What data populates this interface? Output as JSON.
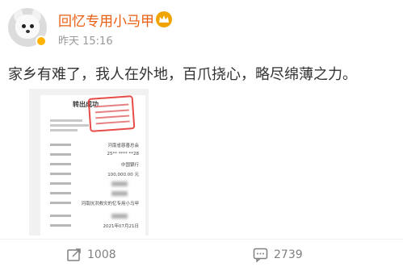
{
  "post": {
    "username": "回忆专用小马甲",
    "time": "昨天 15:16",
    "text": "家乡有难了，我人在外地，百爪挠心，略尽绵薄之力。"
  },
  "receipt": {
    "title": "转出成功",
    "rows": [
      {
        "value": "河南省慈善总会"
      },
      {
        "value": "25** **** **28"
      },
      {
        "value": "中国银行"
      },
      {
        "value": "100,000.00 元"
      },
      {
        "value": ""
      },
      {
        "value": ""
      },
      {
        "value": "河南抗洪救灾的忆专用小马甲"
      },
      {
        "value": ""
      },
      {
        "value": "2021年07月21日"
      }
    ]
  },
  "actions": {
    "repost_count": "1008",
    "comment_count": "2739"
  },
  "colors": {
    "username": "#ea5d0f",
    "badge": "#f0a400",
    "stamp": "#e53935"
  }
}
